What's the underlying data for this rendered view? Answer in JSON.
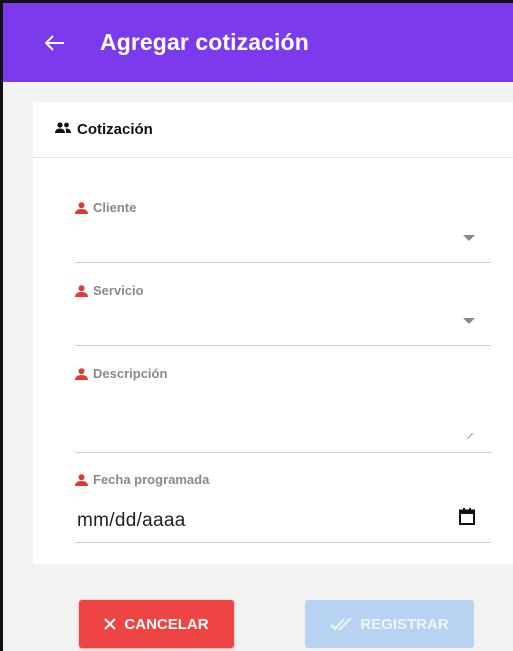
{
  "appbar": {
    "title": "Agregar cotización",
    "icon": "arrow-left-icon"
  },
  "card": {
    "title": "Cotización",
    "icon": "users-icon"
  },
  "fields": {
    "cliente": {
      "label": "Cliente"
    },
    "servicio": {
      "label": "Servicio"
    },
    "descripcion": {
      "label": "Descripción"
    },
    "fecha": {
      "label": "Fecha programada",
      "value": "mm/dd/aaaa"
    }
  },
  "buttons": {
    "cancel": "CANCELAR",
    "register": "REGISTRAR"
  },
  "colors": {
    "appbar": "#7c3aed",
    "required_icon": "#e53935",
    "cancel": "#ef4444",
    "register_disabled": "#b8d3f2"
  }
}
